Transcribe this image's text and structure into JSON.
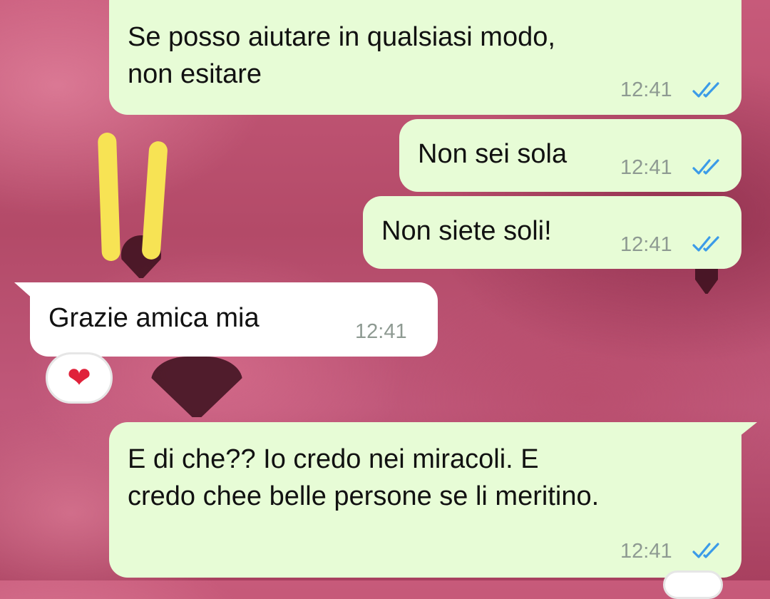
{
  "messages": [
    {
      "direction": "outgoing",
      "text_line1": "Se posso aiutare in qualsiasi modo,",
      "text_line2": "non esitare",
      "time": "12:41",
      "status": "read"
    },
    {
      "direction": "outgoing",
      "text": "Non sei sola",
      "time": "12:41",
      "status": "read"
    },
    {
      "direction": "outgoing",
      "text": "Non siete soli!",
      "time": "12:41",
      "status": "read"
    },
    {
      "direction": "incoming",
      "text": "Grazie amica mia",
      "time": "12:41",
      "reaction": "❤"
    },
    {
      "direction": "outgoing",
      "text_line1": "E di che?? Io credo nei miracoli. E",
      "text_line2": "credo chee belle persone se li meritino.",
      "time": "12:41",
      "status": "read"
    }
  ],
  "colors": {
    "outgoing_bubble": "#e7fcd6",
    "incoming_bubble": "#ffffff",
    "read_ticks": "#3b9be8",
    "timestamp": "#8e9a92",
    "annotation": "#f7e354"
  },
  "icons": {
    "read_status": "double-check-icon",
    "reaction": "red-heart-icon"
  }
}
